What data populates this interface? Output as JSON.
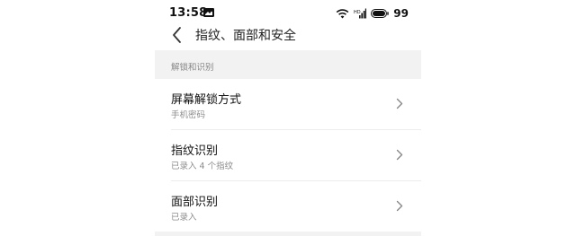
{
  "status_bar": {
    "time": "13:58",
    "battery": "99",
    "icons": [
      "message-icon",
      "wifi-icon",
      "signal-icon",
      "battery-icon"
    ]
  },
  "header": {
    "title": "指纹、面部和安全"
  },
  "section": {
    "label": "解锁和识别"
  },
  "rows": [
    {
      "title": "屏幕解锁方式",
      "subtitle": "手机密码"
    },
    {
      "title": "指纹识别",
      "subtitle": "已录入 4 个指纹"
    },
    {
      "title": "面部识别",
      "subtitle": "已录入"
    }
  ]
}
